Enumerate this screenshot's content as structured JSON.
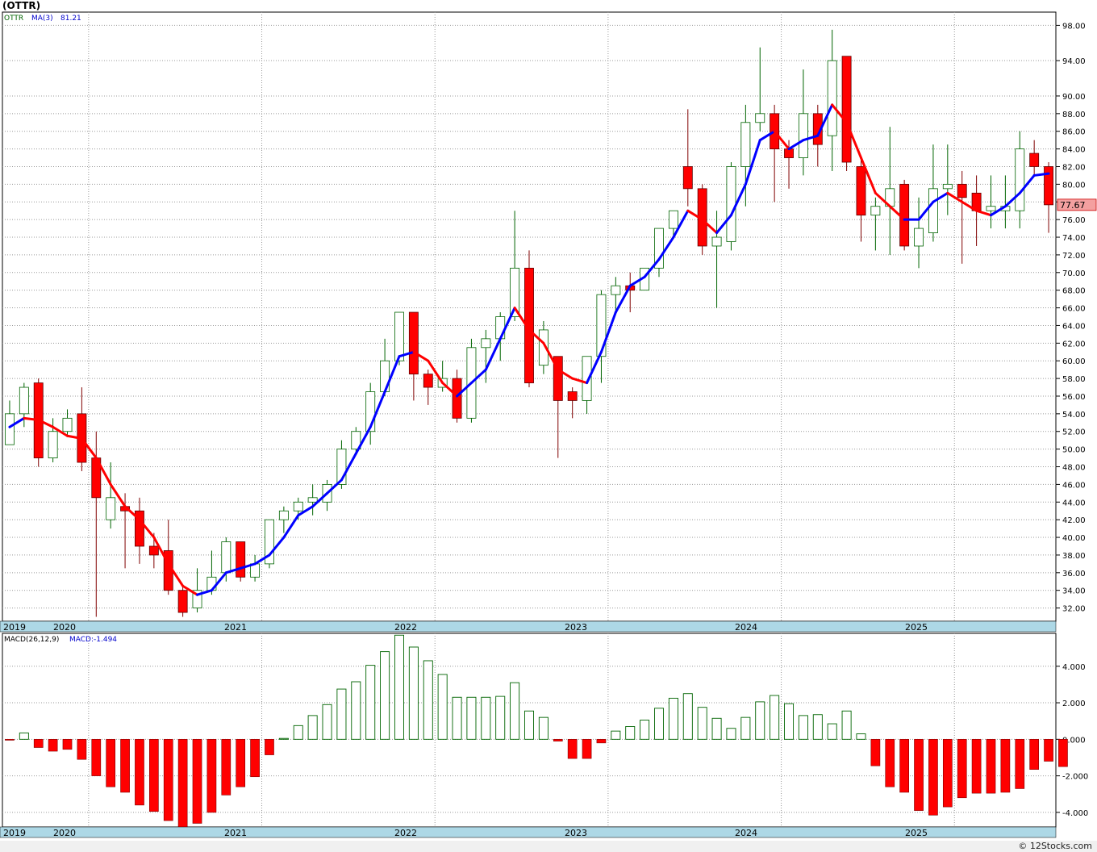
{
  "title": "(OTTR)",
  "credit": "© 12Stocks.com",
  "chart_data": [
    {
      "type": "candlestick",
      "legend": {
        "ticker": "OTTR",
        "ma_label": "MA(3)",
        "ma_value": "81.21"
      },
      "last_price_label": "77.67",
      "ylim": [
        30.5,
        99.5
      ],
      "yticks": [
        32,
        34,
        36,
        38,
        40,
        42,
        44,
        46,
        48,
        50,
        52,
        54,
        56,
        58,
        60,
        62,
        64,
        66,
        68,
        70,
        72,
        74,
        76,
        78,
        80,
        82,
        84,
        86,
        88,
        90,
        94,
        98
      ],
      "ytick_labels": [
        "32.00",
        "34.00",
        "36.00",
        "38.00",
        "40.00",
        "42.00",
        "44.00",
        "46.00",
        "48.00",
        "50.00",
        "52.00",
        "54.00",
        "56.00",
        "58.00",
        "60.00",
        "62.00",
        "64.00",
        "66.00",
        "68.00",
        "70.00",
        "72.00",
        "74.00",
        "76.00",
        "78.00",
        "80.00",
        "82.00",
        "84.00",
        "86.00",
        "88.00",
        "90.00",
        "94.00",
        "98.00"
      ],
      "year_labels": [
        "2019",
        "2020",
        "2021",
        "2022",
        "2023",
        "2024",
        "2025"
      ],
      "colors": {
        "up_fill": "#ffffff",
        "up_stroke": "#006400",
        "down_fill": "#ff0000",
        "ma_up": "#0000ff",
        "ma_down": "#ff0000",
        "axis_band": "#add8e6"
      },
      "candles": [
        {
          "o": 50.5,
          "h": 55.5,
          "l": 50.5,
          "c": 54.0
        },
        {
          "o": 54.0,
          "h": 57.5,
          "l": 52.5,
          "c": 57.0
        },
        {
          "o": 57.5,
          "h": 58.0,
          "l": 48.0,
          "c": 49.0
        },
        {
          "o": 49.0,
          "h": 53.5,
          "l": 48.5,
          "c": 52.0
        },
        {
          "o": 52.0,
          "h": 54.5,
          "l": 51.5,
          "c": 53.5
        },
        {
          "o": 54.0,
          "h": 57.0,
          "l": 47.5,
          "c": 48.5
        },
        {
          "o": 49.0,
          "h": 52.0,
          "l": 31.0,
          "c": 44.5
        },
        {
          "o": 42.0,
          "h": 48.5,
          "l": 41.0,
          "c": 44.5
        },
        {
          "o": 43.5,
          "h": 45.0,
          "l": 36.5,
          "c": 43.0
        },
        {
          "o": 43.0,
          "h": 44.5,
          "l": 37.0,
          "c": 39.0
        },
        {
          "o": 39.0,
          "h": 40.5,
          "l": 36.5,
          "c": 38.0
        },
        {
          "o": 38.5,
          "h": 42.0,
          "l": 33.5,
          "c": 34.0
        },
        {
          "o": 34.0,
          "h": 34.5,
          "l": 31.0,
          "c": 31.5
        },
        {
          "o": 32.0,
          "h": 36.5,
          "l": 31.5,
          "c": 34.0
        },
        {
          "o": 34.0,
          "h": 38.5,
          "l": 33.5,
          "c": 35.5
        },
        {
          "o": 36.0,
          "h": 40.0,
          "l": 35.0,
          "c": 39.5
        },
        {
          "o": 39.5,
          "h": 39.5,
          "l": 35.0,
          "c": 35.5
        },
        {
          "o": 35.5,
          "h": 38.0,
          "l": 35.0,
          "c": 37.0
        },
        {
          "o": 37.0,
          "h": 42.0,
          "l": 36.5,
          "c": 42.0
        },
        {
          "o": 42.0,
          "h": 43.5,
          "l": 40.5,
          "c": 43.0
        },
        {
          "o": 43.0,
          "h": 44.5,
          "l": 42.0,
          "c": 44.0
        },
        {
          "o": 44.0,
          "h": 46.0,
          "l": 42.5,
          "c": 44.5
        },
        {
          "o": 44.0,
          "h": 46.5,
          "l": 43.0,
          "c": 46.0
        },
        {
          "o": 46.0,
          "h": 51.0,
          "l": 45.5,
          "c": 50.0
        },
        {
          "o": 50.0,
          "h": 52.5,
          "l": 49.5,
          "c": 52.0
        },
        {
          "o": 52.0,
          "h": 57.5,
          "l": 50.5,
          "c": 56.5
        },
        {
          "o": 56.5,
          "h": 62.5,
          "l": 56.0,
          "c": 60.0
        },
        {
          "o": 60.0,
          "h": 65.5,
          "l": 59.5,
          "c": 65.5
        },
        {
          "o": 65.5,
          "h": 65.5,
          "l": 55.5,
          "c": 58.5
        },
        {
          "o": 58.5,
          "h": 59.0,
          "l": 55.0,
          "c": 57.0
        },
        {
          "o": 57.0,
          "h": 60.0,
          "l": 56.5,
          "c": 58.0
        },
        {
          "o": 58.0,
          "h": 59.0,
          "l": 53.0,
          "c": 53.5
        },
        {
          "o": 53.5,
          "h": 62.5,
          "l": 53.0,
          "c": 61.5
        },
        {
          "o": 61.5,
          "h": 63.5,
          "l": 57.5,
          "c": 62.5
        },
        {
          "o": 62.5,
          "h": 65.5,
          "l": 60.0,
          "c": 65.0
        },
        {
          "o": 65.0,
          "h": 77.0,
          "l": 64.5,
          "c": 70.5
        },
        {
          "o": 70.5,
          "h": 72.5,
          "l": 57.0,
          "c": 57.5
        },
        {
          "o": 59.5,
          "h": 64.5,
          "l": 58.5,
          "c": 63.5
        },
        {
          "o": 60.5,
          "h": 60.5,
          "l": 49.0,
          "c": 55.5
        },
        {
          "o": 56.5,
          "h": 57.0,
          "l": 53.5,
          "c": 55.5
        },
        {
          "o": 55.5,
          "h": 60.5,
          "l": 54.0,
          "c": 60.5
        },
        {
          "o": 60.5,
          "h": 68.0,
          "l": 57.5,
          "c": 67.5
        },
        {
          "o": 67.5,
          "h": 69.5,
          "l": 65.5,
          "c": 68.5
        },
        {
          "o": 68.5,
          "h": 70.0,
          "l": 65.5,
          "c": 68.0
        },
        {
          "o": 68.0,
          "h": 70.5,
          "l": 68.0,
          "c": 70.5
        },
        {
          "o": 70.5,
          "h": 75.0,
          "l": 69.5,
          "c": 75.0
        },
        {
          "o": 75.0,
          "h": 76.5,
          "l": 74.0,
          "c": 77.0
        },
        {
          "o": 82.0,
          "h": 88.5,
          "l": 77.5,
          "c": 79.5
        },
        {
          "o": 79.5,
          "h": 80.0,
          "l": 72.0,
          "c": 73.0
        },
        {
          "o": 73.0,
          "h": 77.0,
          "l": 66.0,
          "c": 74.0
        },
        {
          "o": 73.5,
          "h": 82.5,
          "l": 72.5,
          "c": 82.0
        },
        {
          "o": 82.0,
          "h": 89.0,
          "l": 77.5,
          "c": 87.0
        },
        {
          "o": 87.0,
          "h": 95.5,
          "l": 86.0,
          "c": 88.0
        },
        {
          "o": 88.0,
          "h": 89.0,
          "l": 78.0,
          "c": 84.0
        },
        {
          "o": 84.0,
          "h": 85.0,
          "l": 79.5,
          "c": 83.0
        },
        {
          "o": 83.0,
          "h": 93.0,
          "l": 81.0,
          "c": 88.0
        },
        {
          "o": 88.0,
          "h": 89.0,
          "l": 82.0,
          "c": 84.5
        },
        {
          "o": 85.5,
          "h": 97.5,
          "l": 81.5,
          "c": 94.0
        },
        {
          "o": 94.5,
          "h": 94.5,
          "l": 81.5,
          "c": 82.5
        },
        {
          "o": 82.0,
          "h": 83.0,
          "l": 73.5,
          "c": 76.5
        },
        {
          "o": 76.5,
          "h": 78.5,
          "l": 72.5,
          "c": 77.5
        },
        {
          "o": 77.5,
          "h": 86.5,
          "l": 72.0,
          "c": 79.5
        },
        {
          "o": 80.0,
          "h": 80.5,
          "l": 72.5,
          "c": 73.0
        },
        {
          "o": 73.0,
          "h": 78.5,
          "l": 70.5,
          "c": 75.0
        },
        {
          "o": 74.5,
          "h": 84.5,
          "l": 73.5,
          "c": 79.5
        },
        {
          "o": 79.5,
          "h": 84.5,
          "l": 76.5,
          "c": 80.0
        },
        {
          "o": 80.0,
          "h": 81.5,
          "l": 71.0,
          "c": 78.5
        },
        {
          "o": 79.0,
          "h": 81.0,
          "l": 73.0,
          "c": 77.0
        },
        {
          "o": 77.0,
          "h": 81.0,
          "l": 75.0,
          "c": 77.5
        },
        {
          "o": 77.0,
          "h": 81.0,
          "l": 75.0,
          "c": 77.5
        },
        {
          "o": 77.0,
          "h": 86.0,
          "l": 75.0,
          "c": 84.0
        },
        {
          "o": 83.5,
          "h": 85.0,
          "l": 81.0,
          "c": 82.0
        },
        {
          "o": 82.0,
          "h": 82.5,
          "l": 74.5,
          "c": 77.67
        }
      ],
      "ma": [
        52.5,
        53.5,
        53.3,
        52.5,
        51.5,
        51.2,
        49.0,
        46.0,
        43.5,
        42.0,
        40.0,
        37.0,
        34.5,
        33.5,
        34.0,
        36.0,
        36.5,
        37.0,
        38.0,
        40.0,
        42.5,
        43.5,
        45.0,
        46.5,
        49.5,
        52.5,
        56.5,
        60.5,
        61.0,
        60.0,
        57.5,
        56.0,
        57.5,
        59.0,
        62.5,
        66.0,
        63.5,
        62.0,
        59.0,
        58.0,
        57.5,
        61.0,
        65.5,
        68.5,
        69.5,
        71.5,
        74.0,
        77.0,
        76.0,
        74.5,
        76.5,
        80.0,
        85.0,
        86.0,
        84.0,
        85.0,
        85.5,
        89.0,
        87.0,
        83.0,
        79.0,
        77.5,
        76.0,
        76.0,
        78.0,
        79.0,
        78.0,
        77.0,
        76.5,
        77.5,
        79.0,
        81.0,
        81.21
      ]
    },
    {
      "type": "bar",
      "legend": {
        "label": "MACD(26,12,9)",
        "value_label": "MACD:-1.494"
      },
      "ylim": [
        -4.8,
        5.8
      ],
      "yticks": [
        -4,
        -2,
        0,
        2,
        4
      ],
      "ytick_labels": [
        "-4.000",
        "-2.000",
        "0.000",
        "2.000",
        "4.000"
      ],
      "year_labels": [
        "2019",
        "2020",
        "2021",
        "2022",
        "2023",
        "2024",
        "2025"
      ],
      "values": [
        -0.05,
        0.35,
        -0.45,
        -0.65,
        -0.55,
        -1.1,
        -2.0,
        -2.6,
        -2.9,
        -3.6,
        -3.95,
        -4.45,
        -4.9,
        -4.6,
        -4.0,
        -3.05,
        -2.6,
        -2.05,
        -0.85,
        0.05,
        0.75,
        1.3,
        1.9,
        2.75,
        3.15,
        4.05,
        4.8,
        5.7,
        5.05,
        4.3,
        3.55,
        2.3,
        2.3,
        2.3,
        2.35,
        3.1,
        1.55,
        1.2,
        -0.1,
        -1.05,
        -1.05,
        -0.2,
        0.45,
        0.7,
        1.05,
        1.7,
        2.25,
        2.5,
        1.75,
        1.15,
        0.6,
        1.2,
        2.05,
        2.4,
        1.95,
        1.3,
        1.35,
        0.85,
        1.55,
        0.3,
        -1.45,
        -2.6,
        -2.9,
        -3.9,
        -4.15,
        -3.7,
        -3.2,
        -2.95,
        -2.95,
        -2.9,
        -2.7,
        -1.65,
        -1.2,
        -1.494
      ]
    }
  ]
}
